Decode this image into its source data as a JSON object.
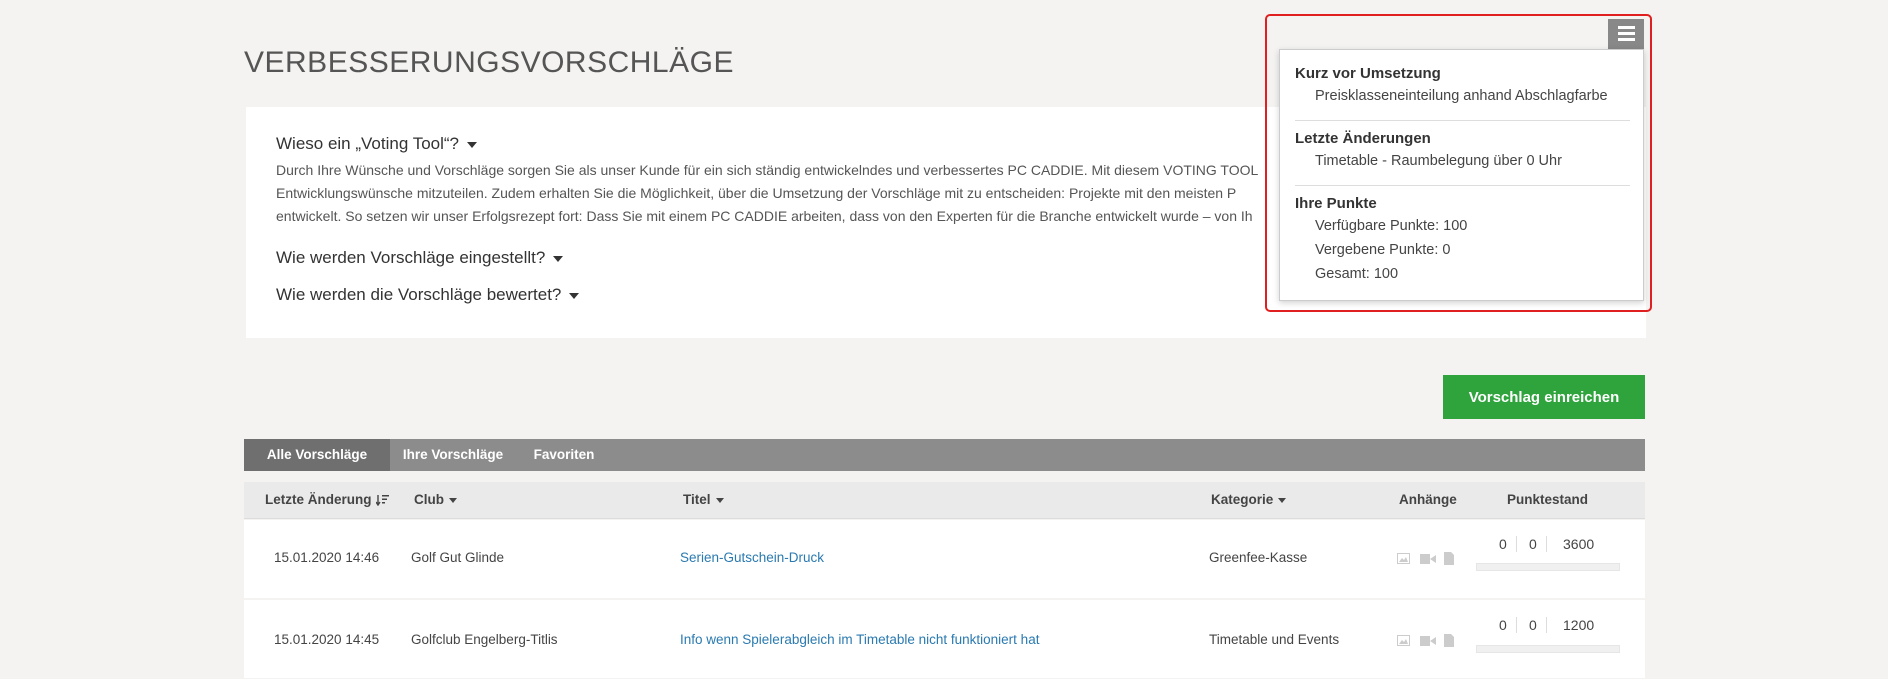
{
  "page": {
    "title": "VERBESSERUNGSVORSCHLÄGE"
  },
  "faq": {
    "q1": "Wieso ein „Voting Tool“?",
    "q1_text": [
      "Durch Ihre Wünsche und Vorschläge sorgen Sie als unser Kunde für ein sich ständig entwickelndes und verbessertes PC CADDIE. Mit diesem VOTING TOOL",
      "Entwicklungswünsche mitzuteilen. Zudem erhalten Sie die Möglichkeit, über die Umsetzung der Vorschläge mit zu entscheiden: Projekte mit den meisten P",
      "entwickelt. So setzen wir unser Erfolgsrezept fort: Dass Sie mit einem PC CADDIE arbeiten, dass von den Experten für die Branche entwickelt wurde – von Ih"
    ],
    "q2": "Wie werden Vorschläge eingestellt?",
    "q3": "Wie werden die Vorschläge bewertet?"
  },
  "dropdown": {
    "sec1_title": "Kurz vor Umsetzung",
    "sec1_item": "Preisklasseneinteilung anhand Abschlagfarbe",
    "sec2_title": "Letzte Änderungen",
    "sec2_item": "Timetable - Raumbelegung über 0 Uhr",
    "sec3_title": "Ihre Punkte",
    "available": "Verfügbare Punkte: 100",
    "assigned": "Vergebene Punkte: 0",
    "total": "Gesamt: 100"
  },
  "actions": {
    "submit_label": "Vorschlag einreichen"
  },
  "tabs": [
    "Alle Vorschläge",
    "Ihre Vorschläge",
    "Favoriten"
  ],
  "table": {
    "headers": {
      "last_change": "Letzte Änderung",
      "club": "Club",
      "title": "Titel",
      "category": "Kategorie",
      "attachments": "Anhänge",
      "score": "Punktestand"
    },
    "rows": [
      {
        "date": "15.01.2020 14:46",
        "club": "Golf Gut Glinde",
        "title": "Serien-Gutschein-Druck",
        "category": "Greenfee-Kasse",
        "s1": "0",
        "s2": "0",
        "s3": "3600"
      },
      {
        "date": "15.01.2020 14:45",
        "club": "Golfclub Engelberg-Titlis",
        "title": "Info wenn Spielerabgleich im Timetable nicht funktioniert hat",
        "category": "Timetable und Events",
        "s1": "0",
        "s2": "0",
        "s3": "1200"
      }
    ]
  },
  "colors": {
    "accent_green": "#2fa33c",
    "link_blue": "#2a7ab0",
    "highlight_red": "#e02020",
    "tab_bar": "#8c8c8c"
  },
  "icons": [
    "menu-icon",
    "image-icon",
    "video-icon",
    "document-icon",
    "sort-icon",
    "caret-down-icon"
  ]
}
